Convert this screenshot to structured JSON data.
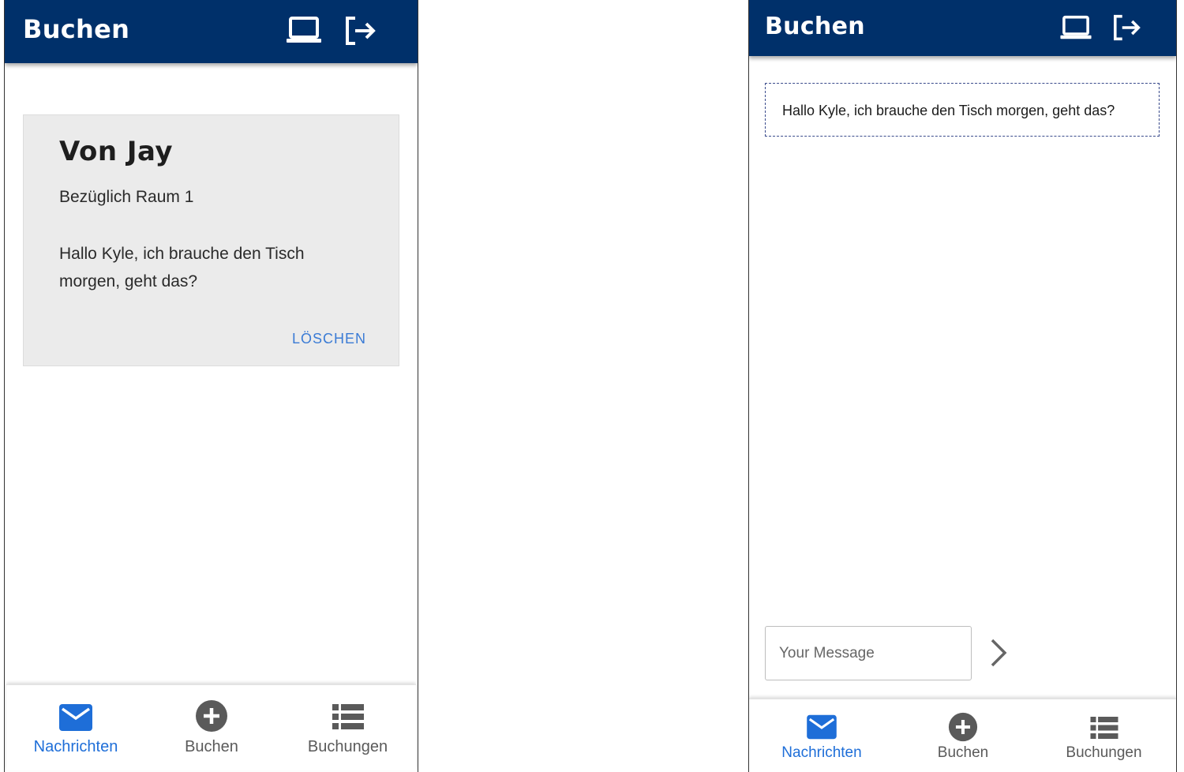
{
  "left_screen": {
    "appbar": {
      "title": "Buchen",
      "icons": [
        "laptop-icon",
        "logout-icon"
      ]
    },
    "message_card": {
      "title": "Von Jay",
      "subject": "Bezüglich Raum 1",
      "body": "Hallo Kyle, ich brauche den Tisch morgen, geht das?",
      "delete_label": "LÖSCHEN"
    },
    "bottom_nav": {
      "items": [
        {
          "label": "Nachrichten",
          "icon": "mail-icon",
          "active": true
        },
        {
          "label": "Buchen",
          "icon": "add-circle-icon",
          "active": false
        },
        {
          "label": "Buchungen",
          "icon": "list-icon",
          "active": false
        }
      ]
    }
  },
  "right_screen": {
    "appbar": {
      "title": "Buchen",
      "icons": [
        "laptop-icon",
        "logout-icon"
      ]
    },
    "chat": {
      "messages": [
        "Hallo Kyle, ich brauche den Tisch morgen, geht das?"
      ],
      "input_placeholder": "Your Message",
      "input_value": "",
      "send_icon": "chevron-right-icon"
    },
    "bottom_nav": {
      "items": [
        {
          "label": "Nachrichten",
          "icon": "mail-icon",
          "active": true
        },
        {
          "label": "Buchen",
          "icon": "add-circle-icon",
          "active": false
        },
        {
          "label": "Buchungen",
          "icon": "list-icon",
          "active": false
        }
      ]
    }
  },
  "colors": {
    "appbar": "#00306a",
    "active_nav": "#1e6ed8",
    "inactive_nav": "#5a5a5a",
    "card_background": "#ebebeb",
    "delete_link": "#3a7bd5"
  }
}
